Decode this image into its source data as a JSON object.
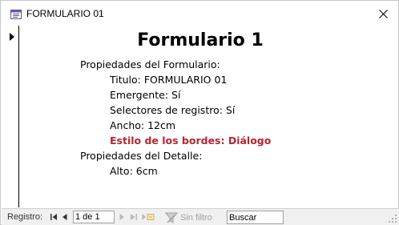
{
  "window": {
    "title": "FORMULARIO 01"
  },
  "form": {
    "title": "Formulario 1",
    "lines": [
      {
        "text": "Propiedades del Formulario:",
        "level": 0,
        "highlight": false
      },
      {
        "text": "Titulo: FORMULARIO 01",
        "level": 1,
        "highlight": false
      },
      {
        "text": "Emergente: Sí",
        "level": 1,
        "highlight": false
      },
      {
        "text": "Selectores de registro: Sí",
        "level": 1,
        "highlight": false
      },
      {
        "text": "Ancho: 12cm",
        "level": 1,
        "highlight": false
      },
      {
        "text": "Estilo de los bordes: Diálogo",
        "level": 1,
        "highlight": true
      },
      {
        "text": "Propiedades del Detalle:",
        "level": 0,
        "highlight": false
      },
      {
        "text": "Alto: 6cm",
        "level": 1,
        "highlight": false
      }
    ]
  },
  "navbar": {
    "record_label": "Registro:",
    "record_value": "1 de 1",
    "filter_label": "Sin filtro",
    "search_value": "Buscar"
  },
  "colors": {
    "highlight_text": "#b3262f",
    "navbar_background": "#f0f0f0"
  },
  "icons": {
    "app": "form-icon",
    "close": "close-icon",
    "current_record": "current-record-arrow-icon",
    "first": "first-record-icon",
    "prev": "previous-record-icon",
    "next": "next-record-icon",
    "last": "last-record-icon",
    "new": "new-record-icon",
    "filter": "no-filter-icon"
  }
}
